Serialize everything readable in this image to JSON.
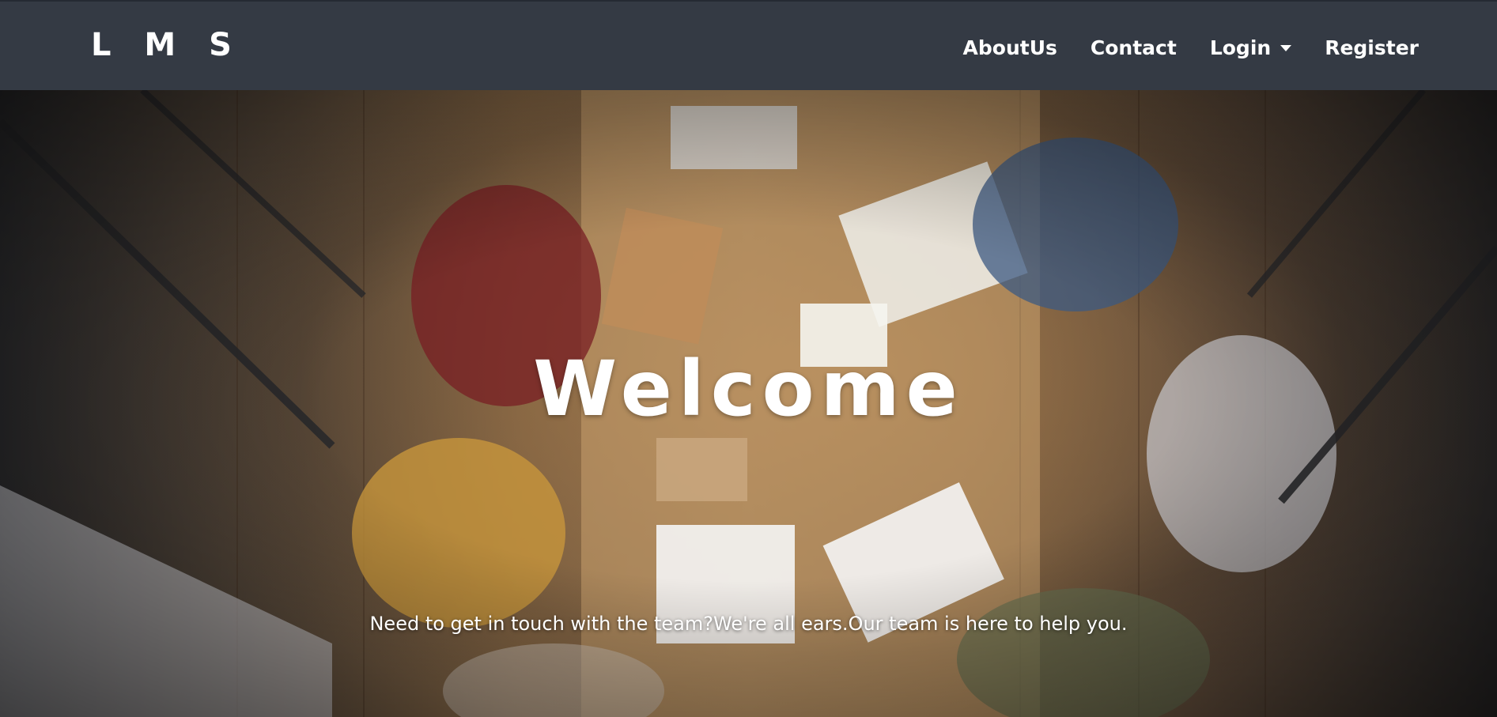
{
  "navbar": {
    "brand": "L M S",
    "links": [
      {
        "label": "AboutUs"
      },
      {
        "label": "Contact"
      },
      {
        "label": "Login"
      },
      {
        "label": "Register"
      }
    ]
  },
  "hero": {
    "heading": "Welcome",
    "tagline": "Need to get in touch with the team?We're all ears.Our team is here to help you."
  }
}
